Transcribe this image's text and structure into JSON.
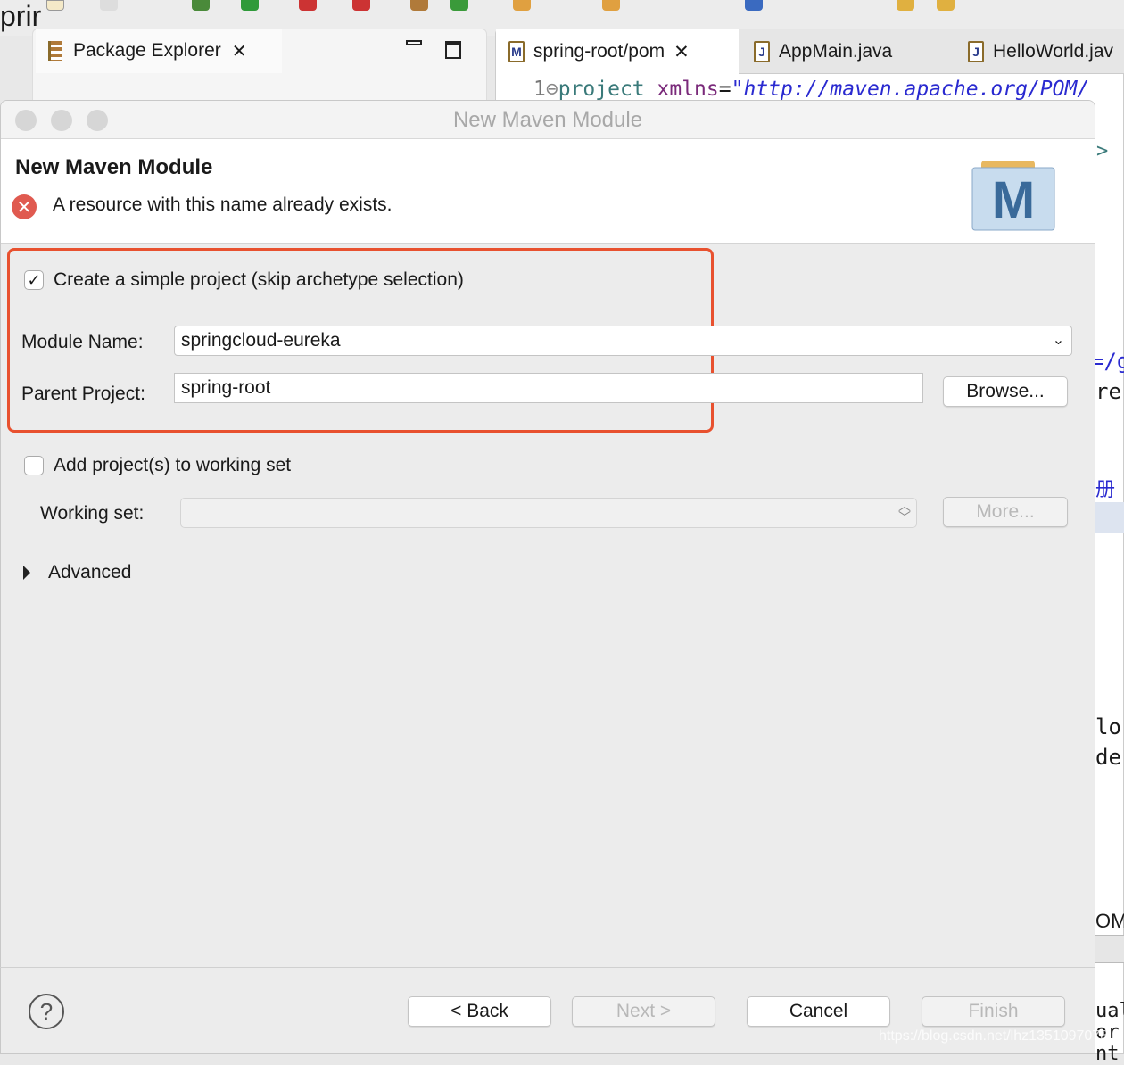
{
  "ide": {
    "left_edge_text": "prir",
    "package_explorer_tab": "Package Explorer",
    "editor_tabs": [
      {
        "label": "spring-root/pom",
        "icon": "maven-file-icon"
      },
      {
        "label": "AppMain.java",
        "icon": "java-file-icon"
      },
      {
        "label": "HelloWorld.jav",
        "icon": "java-file-icon"
      }
    ],
    "editor_line": {
      "number": "1",
      "tag": "project",
      "attr": "xmlns",
      "value": "\"http://maven.apache.org/POM/"
    },
    "right_fragments": [
      ">",
      "=/g",
      "re",
      "册中",
      "lo",
      "de",
      "OM",
      "ual",
      "or",
      "nt"
    ]
  },
  "dialog": {
    "window_title": "New Maven Module",
    "header_title": "New Maven Module",
    "error_message": "A resource with this name already exists.",
    "simple_project": {
      "label": "Create a simple project (skip archetype selection)",
      "checked": true
    },
    "module_name": {
      "label": "Module Name:",
      "value": "springcloud-eureka"
    },
    "parent_project": {
      "label": "Parent Project:",
      "value": "spring-root"
    },
    "browse_label": "Browse...",
    "working_set_checkbox": {
      "label": "Add project(s) to working set",
      "checked": false
    },
    "working_set": {
      "label": "Working set:",
      "value": ""
    },
    "more_label": "More...",
    "advanced_label": "Advanced",
    "buttons": {
      "back": "< Back",
      "next": "Next >",
      "cancel": "Cancel",
      "finish": "Finish"
    },
    "highlight_color": "#e8512f"
  },
  "watermark": "https://blog.csdn.net/lhz1351097078"
}
